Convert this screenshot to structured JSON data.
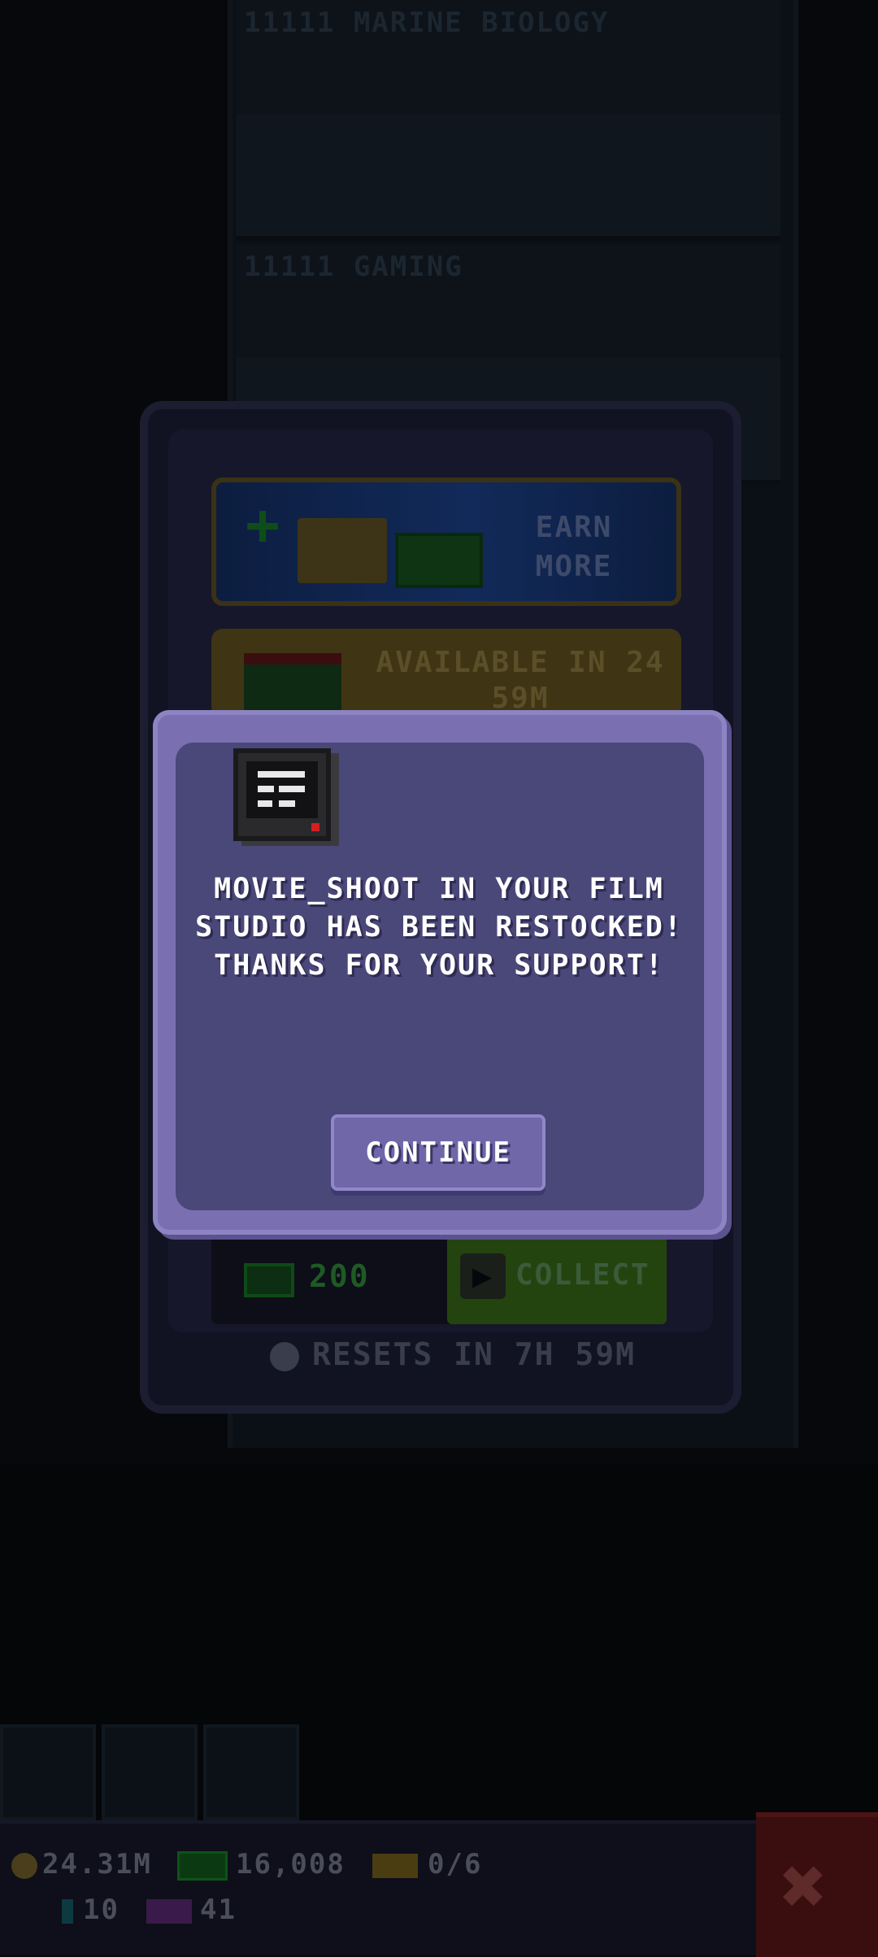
{
  "background": {
    "floors": [
      {
        "title": "11111 MARINE BIOLOGY"
      },
      {
        "title": "11111 GAMING"
      }
    ]
  },
  "shop_panel": {
    "earn_more_label": "EARN MORE",
    "gift_label": "AVAILABLE IN 24 59M",
    "cash_reward": "200",
    "collect_label": "COLLECT",
    "resets_text": "RESETS IN 7H 59M"
  },
  "modal": {
    "icon": "terminal-icon",
    "message": "MOVIE_SHOOT IN YOUR FILM STUDIO HAS BEEN RESTOCKED! THANKS FOR YOUR SUPPORT!",
    "continue_label": "CONTINUE"
  },
  "bottom_bar": {
    "coins": "24.31M",
    "bux": "16,008",
    "tickets": "0/6",
    "gems": "10",
    "tv": "41"
  },
  "colors": {
    "modal_border": "#7a6fb0",
    "modal_fill": "#4a4779",
    "button": "#6f67a8",
    "close_button": "#3a0e0e"
  }
}
